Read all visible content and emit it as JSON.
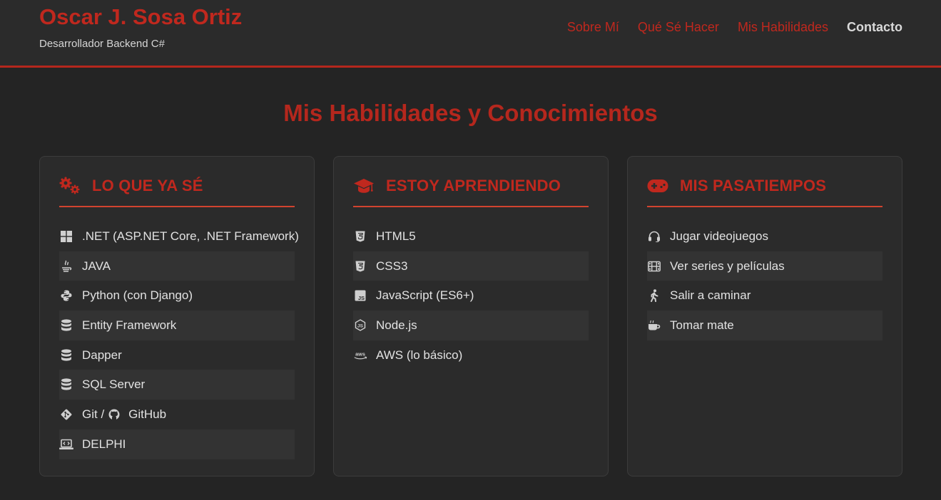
{
  "header": {
    "name": "Oscar J. Sosa Ortiz",
    "role": "Desarrollador Backend C#",
    "nav": [
      {
        "label": "Sobre Mí"
      },
      {
        "label": "Qué Sé Hacer"
      },
      {
        "label": "Mis Habilidades"
      },
      {
        "label": "Contacto",
        "active": true
      }
    ]
  },
  "section": {
    "title": "Mis Habilidades y Conocimientos"
  },
  "cards": [
    {
      "title": "LO QUE YA SÉ",
      "icon": "gears-icon",
      "items": [
        {
          "icon": "windows-icon",
          "label": ".NET (ASP.NET Core, .NET Framework)"
        },
        {
          "icon": "java-icon",
          "label": "JAVA"
        },
        {
          "icon": "python-icon",
          "label": "Python (con Django)"
        },
        {
          "icon": "database-icon",
          "label": "Entity Framework"
        },
        {
          "icon": "database-icon",
          "label": "Dapper"
        },
        {
          "icon": "database-icon",
          "label": "SQL Server"
        },
        {
          "icon": "git-icon",
          "label_a": "Git /",
          "label_b": "GitHub",
          "second_icon": "github-icon"
        },
        {
          "icon": "laptop-code-icon",
          "label": "DELPHI"
        }
      ]
    },
    {
      "title": "ESTOY APRENDIENDO",
      "icon": "graduation-cap-icon",
      "items": [
        {
          "icon": "html5-icon",
          "label": "HTML5"
        },
        {
          "icon": "css3-icon",
          "label": "CSS3"
        },
        {
          "icon": "js-icon",
          "label": "JavaScript (ES6+)"
        },
        {
          "icon": "nodejs-icon",
          "label": "Node.js"
        },
        {
          "icon": "aws-icon",
          "label": "AWS (lo básico)"
        }
      ]
    },
    {
      "title": "MIS PASATIEMPOS",
      "icon": "gamepad-icon",
      "items": [
        {
          "icon": "headset-icon",
          "label": "Jugar videojuegos"
        },
        {
          "icon": "film-icon",
          "label": "Ver series y películas"
        },
        {
          "icon": "walking-icon",
          "label": "Salir a caminar"
        },
        {
          "icon": "mug-icon",
          "label": "Tomar mate"
        }
      ]
    }
  ],
  "colors": {
    "accent": "#c0281e",
    "background": "#242424",
    "card": "#2b2b2b",
    "row_alt": "#333333"
  }
}
